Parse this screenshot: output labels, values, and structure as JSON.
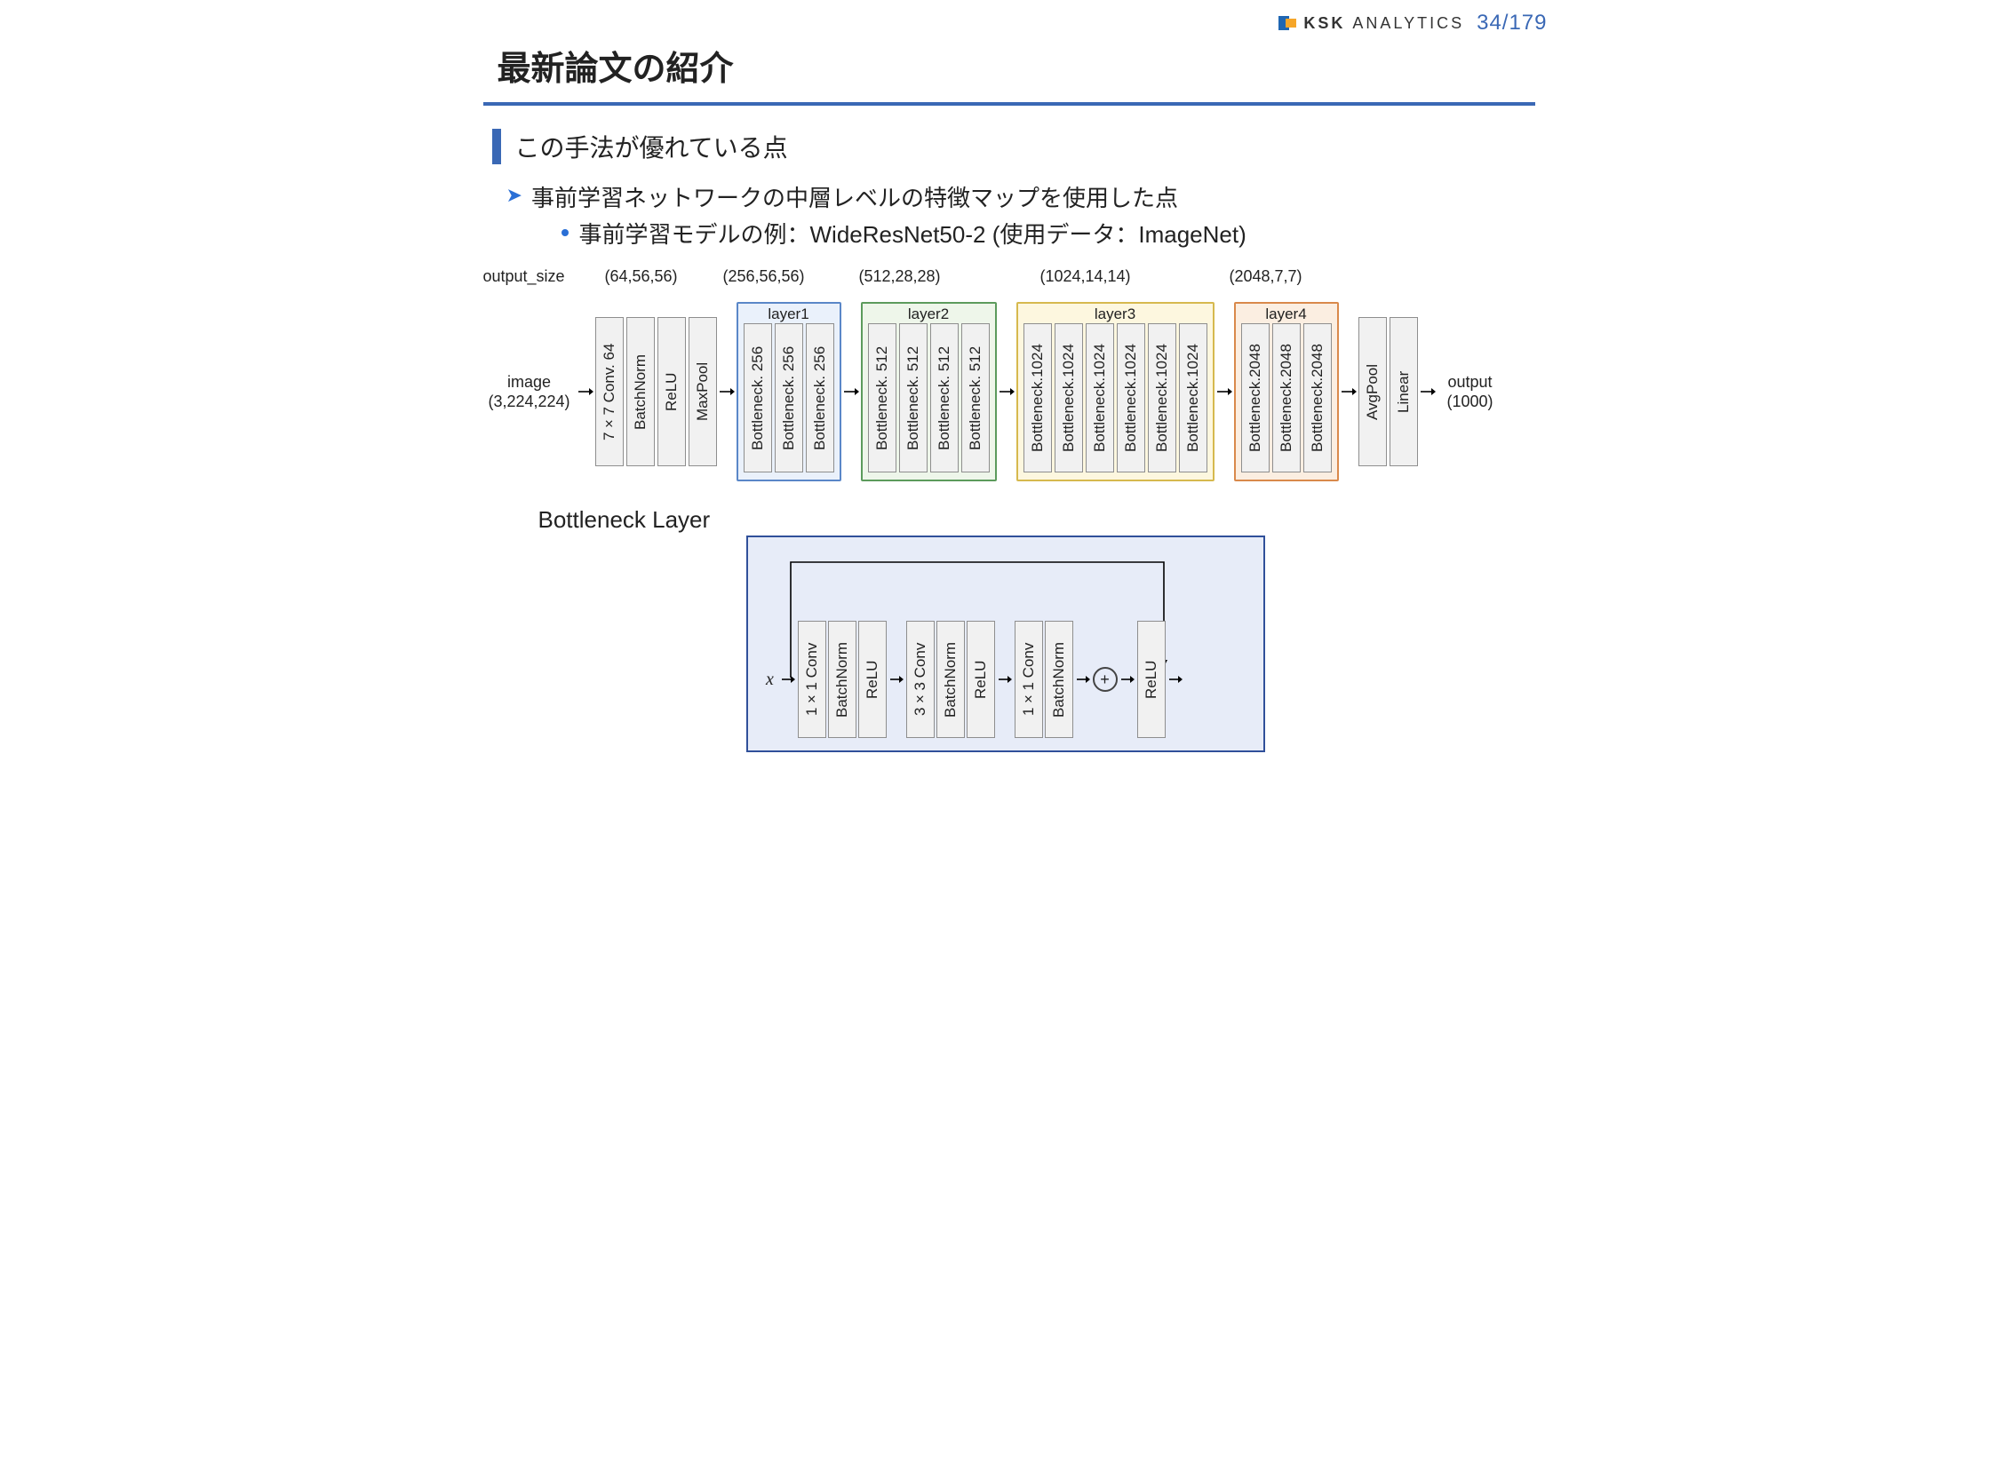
{
  "brand": {
    "name_bold": "KSK",
    "name_light": "ANALYTICS"
  },
  "pager": "34/179",
  "title": "最新論文の紹介",
  "subheader": "この手法が優れている点",
  "bullet1": "事前学習ネットワークの中層レベルの特徴マップを使用した点",
  "bullet2": "事前学習モデルの例：WideResNet50-2 (使用データ：ImageNet)",
  "sizes_label": "output_size",
  "output_sizes": [
    "(64,56,56)",
    "(256,56,56)",
    "(512,28,28)",
    "(1024,14,14)",
    "(2048,7,7)"
  ],
  "input": {
    "label": "image",
    "shape": "(3,224,224)"
  },
  "output": {
    "label": "output",
    "shape": "(1000)"
  },
  "stem": [
    "7×7 Conv. 64",
    "BatchNorm",
    "ReLU",
    "MaxPool"
  ],
  "layers": [
    {
      "name": "layer1",
      "blocks": [
        "Bottleneck. 256",
        "Bottleneck. 256",
        "Bottleneck. 256"
      ]
    },
    {
      "name": "layer2",
      "blocks": [
        "Bottleneck. 512",
        "Bottleneck. 512",
        "Bottleneck. 512",
        "Bottleneck. 512"
      ]
    },
    {
      "name": "layer3",
      "blocks": [
        "Bottleneck.1024",
        "Bottleneck.1024",
        "Bottleneck.1024",
        "Bottleneck.1024",
        "Bottleneck.1024",
        "Bottleneck.1024"
      ]
    },
    {
      "name": "layer4",
      "blocks": [
        "Bottleneck.2048",
        "Bottleneck.2048",
        "Bottleneck.2048"
      ]
    }
  ],
  "tail": [
    "AvgPool",
    "Linear"
  ],
  "bottleneck": {
    "title": "Bottleneck Layer",
    "input_symbol": "x",
    "ops": [
      "1×1 Conv",
      "BatchNorm",
      "ReLU",
      "3×3 Conv",
      "BatchNorm",
      "ReLU",
      "1×1 Conv",
      "BatchNorm"
    ],
    "post": "ReLU",
    "merge": "⊕"
  }
}
